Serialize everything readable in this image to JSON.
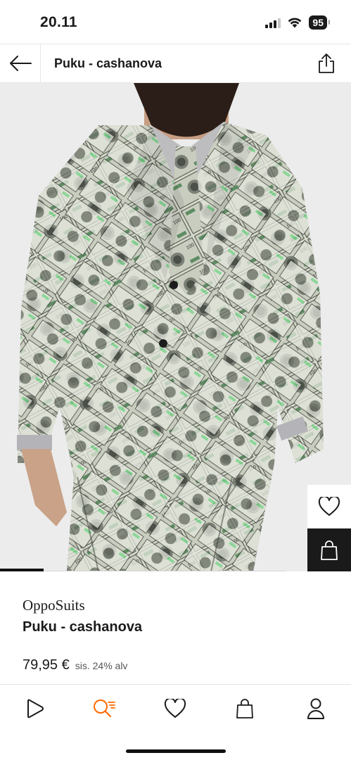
{
  "status_bar": {
    "time": "20.11",
    "battery": "95"
  },
  "header": {
    "title": "Puku - cashanova",
    "back_icon": "arrow-left-icon",
    "share_icon": "share-icon"
  },
  "product": {
    "brand": "OppoSuits",
    "name": "Puku - cashanova",
    "price": "79,95 €",
    "tax_note": "sis. 24% alv",
    "image_description_icon": "product-photo",
    "wishlist_icon": "heart-icon",
    "cart_icon": "shopping-bag-icon"
  },
  "bottom_nav": {
    "items": [
      {
        "icon": "home-play-icon"
      },
      {
        "icon": "search-icon",
        "active": true
      },
      {
        "icon": "heart-icon"
      },
      {
        "icon": "shopping-bag-icon"
      },
      {
        "icon": "profile-icon"
      }
    ]
  },
  "colors": {
    "accent": "#ff6900",
    "text": "#1a1a1a",
    "cart_button": "#1a1a1a"
  }
}
